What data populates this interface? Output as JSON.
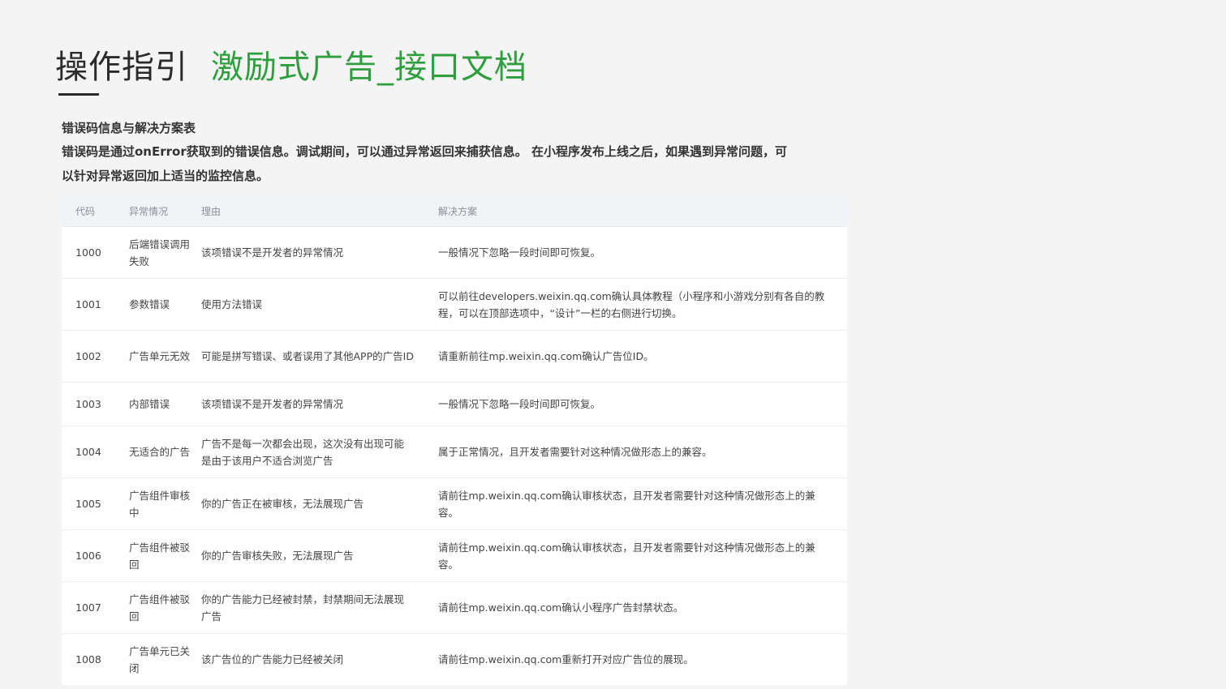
{
  "header": {
    "title": "操作指引",
    "subtitle": "激励式广告_接口文档"
  },
  "intro": {
    "heading": "错误码信息与解决方案表",
    "text": "错误码是通过onError获取到的错误信息。调试期间，可以通过异常返回来捕获信息。 在小程序发布上线之后，如果遇到异常问题，可以针对异常返回加上适当的监控信息。"
  },
  "table": {
    "headers": [
      "代码",
      "异常情况",
      "理由",
      "解决方案"
    ],
    "rows": [
      {
        "code": "1000",
        "situation": "后端错误调用失败",
        "reason": "该项错误不是开发者的异常情况",
        "solution": "一般情况下忽略一段时间即可恢复。"
      },
      {
        "code": "1001",
        "situation": "参数错误",
        "reason": "使用方法错误",
        "solution": "可以前往developers.weixin.qq.com确认具体教程（小程序和小游戏分别有各自的教程，可以在顶部选项中，“设计”一栏的右侧进行切换。"
      },
      {
        "code": "1002",
        "situation": "广告单元无效",
        "reason": "可能是拼写错误、或者误用了其他APP的广告ID",
        "solution": "请重新前往mp.weixin.qq.com确认广告位ID。"
      },
      {
        "code": "1003",
        "situation": "内部错误",
        "reason": "该项错误不是开发者的异常情况",
        "solution": "一般情况下忽略一段时间即可恢复。"
      },
      {
        "code": "1004",
        "situation": "无适合的广告",
        "reason": "广告不是每一次都会出现，这次没有出现可能是由于该用户不适合浏览广告",
        "solution": "属于正常情况，且开发者需要针对这种情况做形态上的兼容。"
      },
      {
        "code": "1005",
        "situation": "广告组件审核中",
        "reason": "你的广告正在被审核，无法展现广告",
        "solution": "请前往mp.weixin.qq.com确认审核状态，且开发者需要针对这种情况做形态上的兼容。"
      },
      {
        "code": "1006",
        "situation": "广告组件被驳回",
        "reason": "你的广告审核失败，无法展现广告",
        "solution": "请前往mp.weixin.qq.com确认审核状态，且开发者需要针对这种情况做形态上的兼容。"
      },
      {
        "code": "1007",
        "situation": "广告组件被驳回",
        "reason": "你的广告能力已经被封禁，封禁期间无法展现广告",
        "solution": "请前往mp.weixin.qq.com确认小程序广告封禁状态。"
      },
      {
        "code": "1008",
        "situation": "广告单元已关闭",
        "reason": "该广告位的广告能力已经被关闭",
        "solution": "请前往mp.weixin.qq.com重新打开对应广告位的展现。"
      }
    ]
  }
}
